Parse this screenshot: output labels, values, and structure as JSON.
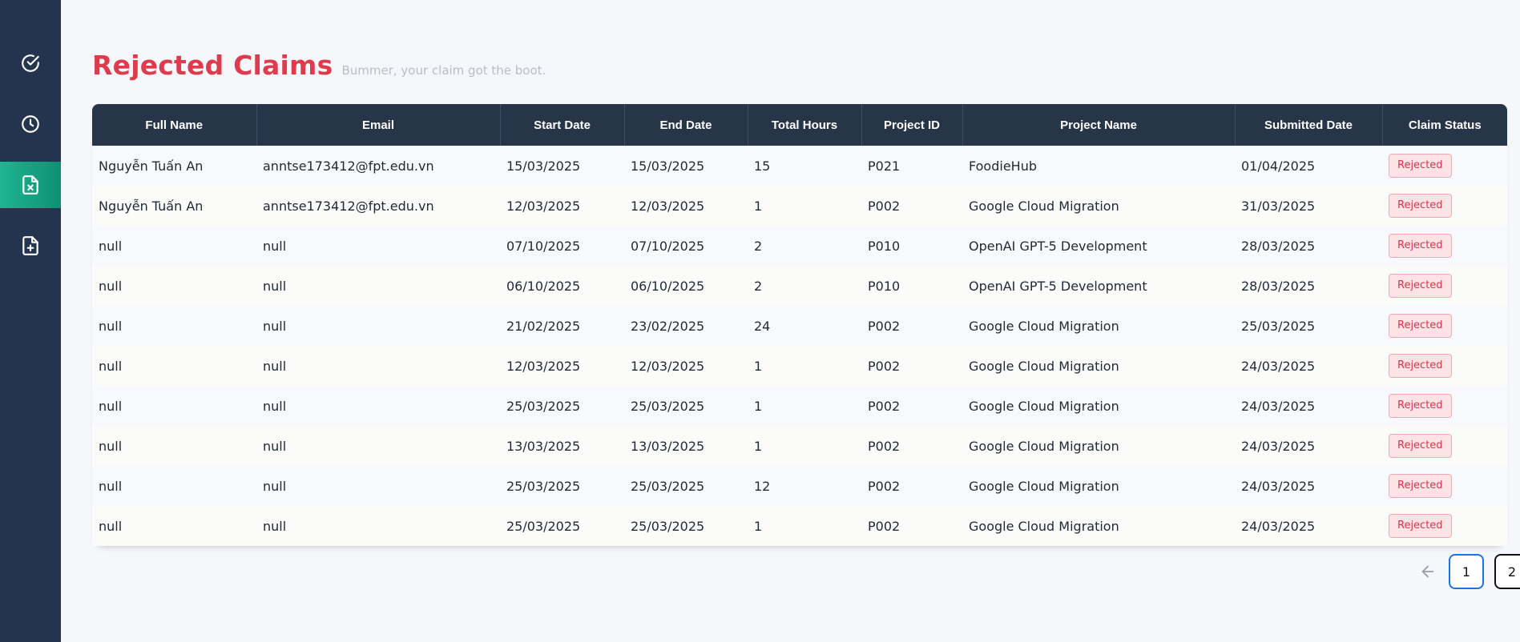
{
  "sidebar": {
    "items": [
      {
        "icon": "check-circle-icon",
        "active": false
      },
      {
        "icon": "clock-icon",
        "active": false
      },
      {
        "icon": "file-x-icon",
        "active": true
      },
      {
        "icon": "file-plus-icon",
        "active": false
      }
    ],
    "accent": "#1fb592",
    "background": "#24344f"
  },
  "header": {
    "title": "Rejected Claims",
    "subtitle": "Bummer, your claim got the boot."
  },
  "table": {
    "columns": [
      "Full Name",
      "Email",
      "Start Date",
      "End Date",
      "Total Hours",
      "Project ID",
      "Project Name",
      "Submitted Date",
      "Claim Status"
    ],
    "rows": [
      [
        "Nguyễn Tuấn An",
        "anntse173412@fpt.edu.vn",
        "15/03/2025",
        "15/03/2025",
        "15",
        "P021",
        "FoodieHub",
        "01/04/2025",
        "Rejected"
      ],
      [
        "Nguyễn Tuấn An",
        "anntse173412@fpt.edu.vn",
        "12/03/2025",
        "12/03/2025",
        "1",
        "P002",
        "Google Cloud Migration",
        "31/03/2025",
        "Rejected"
      ],
      [
        "null",
        "null",
        "07/10/2025",
        "07/10/2025",
        "2",
        "P010",
        "OpenAI GPT-5 Development",
        "28/03/2025",
        "Rejected"
      ],
      [
        "null",
        "null",
        "06/10/2025",
        "06/10/2025",
        "2",
        "P010",
        "OpenAI GPT-5 Development",
        "28/03/2025",
        "Rejected"
      ],
      [
        "null",
        "null",
        "21/02/2025",
        "23/02/2025",
        "24",
        "P002",
        "Google Cloud Migration",
        "25/03/2025",
        "Rejected"
      ],
      [
        "null",
        "null",
        "12/03/2025",
        "12/03/2025",
        "1",
        "P002",
        "Google Cloud Migration",
        "24/03/2025",
        "Rejected"
      ],
      [
        "null",
        "null",
        "25/03/2025",
        "25/03/2025",
        "1",
        "P002",
        "Google Cloud Migration",
        "24/03/2025",
        "Rejected"
      ],
      [
        "null",
        "null",
        "13/03/2025",
        "13/03/2025",
        "1",
        "P002",
        "Google Cloud Migration",
        "24/03/2025",
        "Rejected"
      ],
      [
        "null",
        "null",
        "25/03/2025",
        "25/03/2025",
        "12",
        "P002",
        "Google Cloud Migration",
        "24/03/2025",
        "Rejected"
      ],
      [
        "null",
        "null",
        "25/03/2025",
        "25/03/2025",
        "1",
        "P002",
        "Google Cloud Migration",
        "24/03/2025",
        "Rejected"
      ]
    ],
    "status_color": "#d8364a",
    "header_color": "#263548"
  },
  "pagination": {
    "prev_icon": "arrow-left-icon",
    "next_icon": "arrow-right-icon",
    "pages": [
      "1",
      "2"
    ],
    "current": "1"
  }
}
